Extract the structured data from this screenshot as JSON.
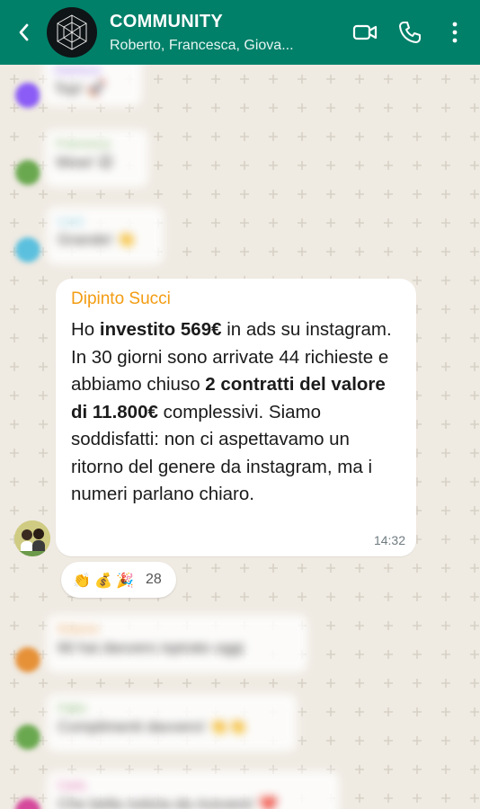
{
  "header": {
    "title": "COMMUNITY",
    "subtitle": "Roberto, Francesca, Giova..."
  },
  "colors": {
    "header_bg": "#008069",
    "chat_bg": "#efeae2",
    "sender_name": "#f39c12"
  },
  "blurred_messages": [
    {
      "name": "Gianluca",
      "text": "Top! 🚀",
      "avatar_color": "#8b5cf6",
      "name_color": "#8b5cf6"
    },
    {
      "name": "Francesca",
      "text": "Wow! 😮",
      "avatar_color": "#6aa84f",
      "name_color": "#6aa84f"
    },
    {
      "name": "Luca",
      "text": "Grande! 👏",
      "avatar_color": "#5bc0de",
      "name_color": "#5bc0de"
    }
  ],
  "main_message": {
    "sender": "Dipinto Succi",
    "text_parts": [
      {
        "t": "Ho ",
        "b": false
      },
      {
        "t": "investito 569€",
        "b": true
      },
      {
        "t": " in ads su instagram. In 30 giorni sono arrivate 44 richieste e abbiamo chiuso ",
        "b": false
      },
      {
        "t": "2 contratti del valore di 11.800€",
        "b": true
      },
      {
        "t": " complessivi. Siamo soddisfatti: non ci aspettavamo un ritorno del genere da instagram, ma i numeri parlano chiaro.",
        "b": false
      }
    ],
    "time": "14:32"
  },
  "reactions": {
    "emojis": [
      "👏",
      "💰",
      "🎉"
    ],
    "count": "28"
  },
  "blurred_after": [
    {
      "name": "Roberto",
      "text": "Mi hai davvero ispirato oggi",
      "avatar_color": "#e69138",
      "name_color": "#e69138"
    },
    {
      "name": "Fabio",
      "text": "Complimenti davvero! 👏👏",
      "avatar_color": "#6aa84f",
      "name_color": "#6aa84f"
    },
    {
      "name": "Carla",
      "text": "Che bella notizia da ricevere! ❤️",
      "avatar_color": "#d5489b",
      "name_color": "#d5489b"
    }
  ],
  "icons": {
    "back": "chevron-left-icon",
    "video": "video-call-icon",
    "call": "phone-icon",
    "menu": "more-vertical-icon"
  }
}
